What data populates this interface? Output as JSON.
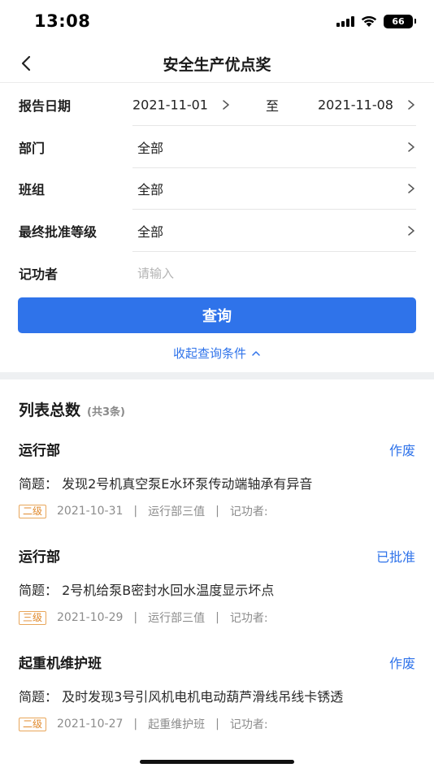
{
  "status_bar": {
    "time": "13:08",
    "battery": "66"
  },
  "nav": {
    "title": "安全生产优点奖"
  },
  "filters": {
    "report_date": {
      "label": "报告日期",
      "start": "2021-11-01",
      "to": "至",
      "end": "2021-11-08"
    },
    "department": {
      "label": "部门",
      "value": "全部"
    },
    "team": {
      "label": "班组",
      "value": "全部"
    },
    "final_level": {
      "label": "最终批准等级",
      "value": "全部"
    },
    "recorder": {
      "label": "记功者",
      "placeholder": "请输入"
    }
  },
  "query_button": "查询",
  "collapse_link": "收起查询条件",
  "list": {
    "title": "列表总数",
    "count": "(共3条)",
    "records": [
      {
        "dept": "运行部",
        "status": "作废",
        "brief": "简题： 发现2号机真空泵E水环泵传动端轴承有异音",
        "level": "二级",
        "date": "2021-10-31",
        "team": "运行部三值",
        "recorder": "记功者:"
      },
      {
        "dept": "运行部",
        "status": "已批准",
        "brief": "简题：  2号机给泵B密封水回水温度显示坏点",
        "level": "三级",
        "date": "2021-10-29",
        "team": "运行部三值",
        "recorder": "记功者:"
      },
      {
        "dept": "起重机维护班",
        "status": "作废",
        "brief": "简题： 及时发现3号引风机电机电动葫芦滑线吊线卡锈透",
        "level": "二级",
        "date": "2021-10-27",
        "team": "起重维护班",
        "recorder": "记功者:"
      }
    ]
  },
  "colors": {
    "accent": "#2f73ea",
    "badge": "#e08a2e",
    "separator": "#eef0f2"
  }
}
